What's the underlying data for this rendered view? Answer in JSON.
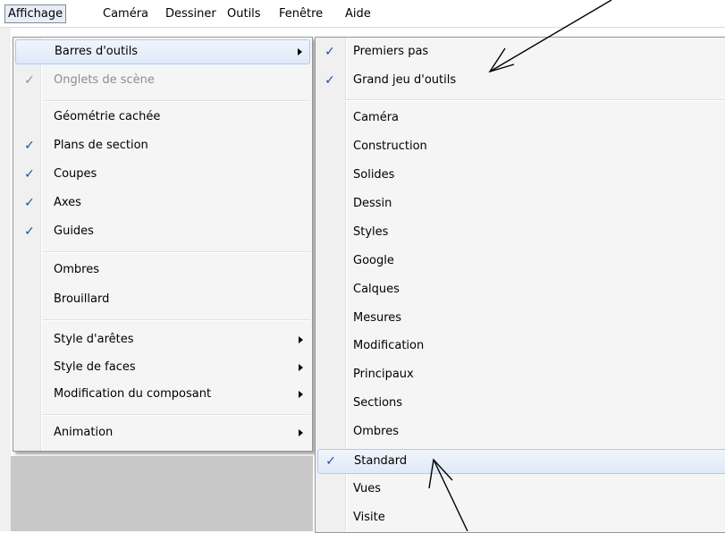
{
  "menubar": {
    "items": [
      {
        "label": "Affichage",
        "open": true
      },
      {
        "label": "Caméra"
      },
      {
        "label": "Dessiner"
      },
      {
        "label": "Outils"
      },
      {
        "label": "Fenêtre"
      },
      {
        "label": "Aide"
      }
    ]
  },
  "view_menu": {
    "items": [
      {
        "label": "Barres d'outils",
        "checked": false,
        "submenu": true,
        "highlighted": true
      },
      {
        "label": "Onglets de scène",
        "checked": true,
        "disabled": true
      },
      {
        "label": "Géométrie cachée",
        "checked": false
      },
      {
        "label": "Plans de section",
        "checked": true
      },
      {
        "label": "Coupes",
        "checked": true
      },
      {
        "label": "Axes",
        "checked": true
      },
      {
        "label": "Guides",
        "checked": true
      },
      {
        "label": "Ombres",
        "checked": false
      },
      {
        "label": "Brouillard",
        "checked": false
      },
      {
        "label": "Style d'arêtes",
        "submenu": true
      },
      {
        "label": "Style de faces",
        "submenu": true
      },
      {
        "label": "Modification du composant",
        "submenu": true
      },
      {
        "label": "Animation",
        "submenu": true
      }
    ]
  },
  "toolbars_submenu": {
    "items": [
      {
        "label": "Premiers pas",
        "checked": true
      },
      {
        "label": "Grand jeu d'outils",
        "checked": true
      },
      {
        "label": "Caméra",
        "checked": false
      },
      {
        "label": "Construction",
        "checked": false
      },
      {
        "label": "Solides",
        "checked": false
      },
      {
        "label": "Dessin",
        "checked": false
      },
      {
        "label": "Styles",
        "checked": false
      },
      {
        "label": "Google",
        "checked": false
      },
      {
        "label": "Calques",
        "checked": false
      },
      {
        "label": "Mesures",
        "checked": false
      },
      {
        "label": "Modification",
        "checked": false
      },
      {
        "label": "Principaux",
        "checked": false
      },
      {
        "label": "Sections",
        "checked": false
      },
      {
        "label": "Ombres",
        "checked": false
      },
      {
        "label": "Standard",
        "checked": true,
        "highlighted": true
      },
      {
        "label": "Vues",
        "checked": false
      },
      {
        "label": "Visite",
        "checked": false
      }
    ]
  },
  "icons": {
    "check": "check-icon",
    "submenu_arrow": "submenu-arrow-icon",
    "annotation_arrow": "annotation-arrow"
  },
  "glyphs": {
    "check": "✓"
  },
  "colors": {
    "check": "#1b4fa5",
    "highlight_border": "#aecaf0",
    "disabled_text": "#8d8d8d"
  }
}
